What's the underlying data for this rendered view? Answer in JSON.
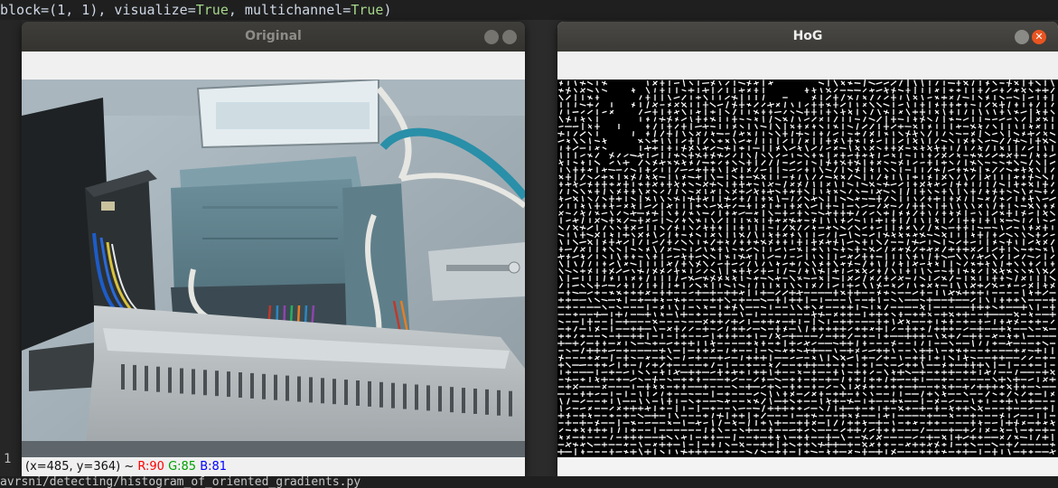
{
  "terminal": {
    "top_line_code": "block=(1, 1), visualize=",
    "top_line_true1": "True",
    "top_line_mid": ", multichannel=",
    "top_line_true2": "True",
    "top_line_end": ")",
    "bottom_line": "avrsni/detecting/histogram_of_oriented_gradients.py",
    "side_marker": "1"
  },
  "windows": {
    "original": {
      "title": "Original",
      "status": {
        "coords": "(x=485, y=364) ~ ",
        "r": "R:90",
        "g": "G:85",
        "b": "B:81"
      }
    },
    "hog": {
      "title": "HoG"
    }
  },
  "colors": {
    "r_label": "#ff0000",
    "g_label": "#00a000",
    "b_label": "#0000ff",
    "close_active": "#e95420",
    "btn_inactive": "#8a8a86",
    "cable_blue": "#2a8fa8"
  },
  "icons": {
    "minimize": "minimize-icon",
    "close": "close-icon"
  }
}
